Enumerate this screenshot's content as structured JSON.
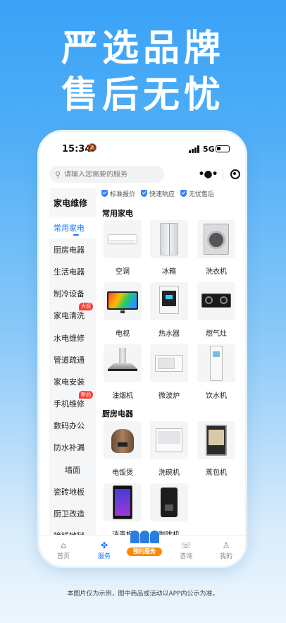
{
  "hero": {
    "line1": "严选品牌",
    "line2": "售后无忧"
  },
  "status_bar": {
    "time": "15:34",
    "network": "5G"
  },
  "search": {
    "placeholder": "请输入您需要的服务"
  },
  "sidebar": {
    "heading": "家电维修",
    "items": [
      {
        "label": "常用家电",
        "active": true
      },
      {
        "label": "厨房电器"
      },
      {
        "label": "生活电器"
      },
      {
        "label": "制冷设备"
      },
      {
        "label": "家电清洗",
        "badge": "大促"
      },
      {
        "label": "水电维修"
      },
      {
        "label": "管道疏通"
      },
      {
        "label": "家电安装"
      },
      {
        "label": "手机维修",
        "badge": "新品"
      },
      {
        "label": "数码办公"
      },
      {
        "label": "防水补漏"
      },
      {
        "label": "墙面"
      },
      {
        "label": "瓷砖地板"
      },
      {
        "label": "厨卫改造"
      },
      {
        "label": "接钱地狱"
      }
    ]
  },
  "guarantees": [
    "标准报价",
    "快速响应",
    "无忧售后"
  ],
  "sections": [
    {
      "title": "常用家电",
      "items": [
        {
          "label": "空调",
          "icon": "air-conditioner-icon"
        },
        {
          "label": "冰箱",
          "icon": "refrigerator-icon"
        },
        {
          "label": "洗衣机",
          "icon": "washing-machine-icon"
        },
        {
          "label": "电视",
          "icon": "tv-icon"
        },
        {
          "label": "热水器",
          "icon": "water-heater-icon"
        },
        {
          "label": "燃气灶",
          "icon": "gas-stove-icon"
        },
        {
          "label": "油烟机",
          "icon": "range-hood-icon"
        },
        {
          "label": "微波炉",
          "icon": "microwave-icon"
        },
        {
          "label": "饮水机",
          "icon": "water-dispenser-icon"
        }
      ]
    },
    {
      "title": "厨房电器",
      "items": [
        {
          "label": "电饭煲",
          "icon": "rice-cooker-icon"
        },
        {
          "label": "洗碗机",
          "icon": "dishwasher-icon"
        },
        {
          "label": "蒸包机",
          "icon": "steamer-icon"
        },
        {
          "label": "消毒柜",
          "icon": "sterilizer-icon"
        },
        {
          "label": "咖啡机",
          "icon": "coffee-machine-icon"
        }
      ]
    }
  ],
  "tabbar": {
    "home": "首页",
    "service": "服务",
    "promo": "预约服务",
    "consult": "咨询",
    "mine": "我的"
  },
  "colors": {
    "accent": "#1677ff",
    "badge": "#f5413b",
    "promo": "#ff8a00"
  },
  "disclaimer": "本图片仅为示例，图中商品或活动以APP内公示为准。"
}
